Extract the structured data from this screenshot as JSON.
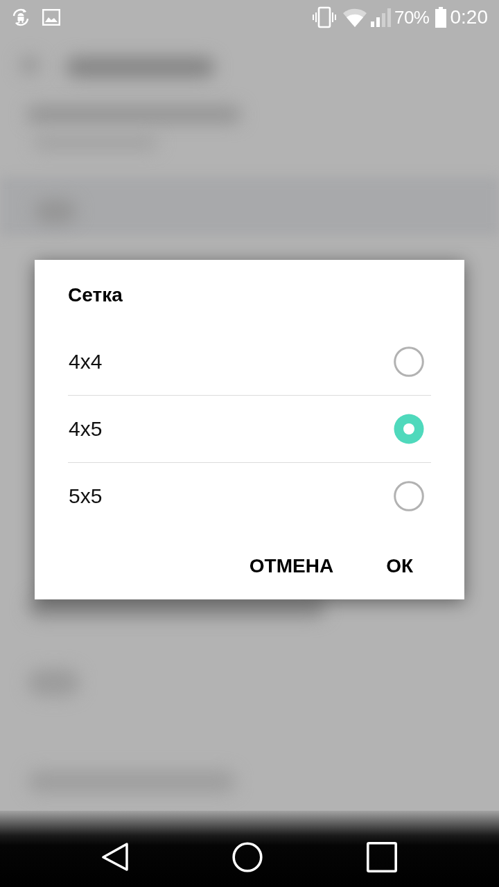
{
  "status_bar": {
    "battery": "70%",
    "time": "0:20"
  },
  "dialog": {
    "title": "Сетка",
    "options": [
      {
        "label": "4x4",
        "selected": false
      },
      {
        "label": "4x5",
        "selected": true
      },
      {
        "label": "5x5",
        "selected": false
      }
    ],
    "buttons": [
      {
        "label": "ОТМЕНА"
      },
      {
        "label": "ОК"
      }
    ]
  }
}
